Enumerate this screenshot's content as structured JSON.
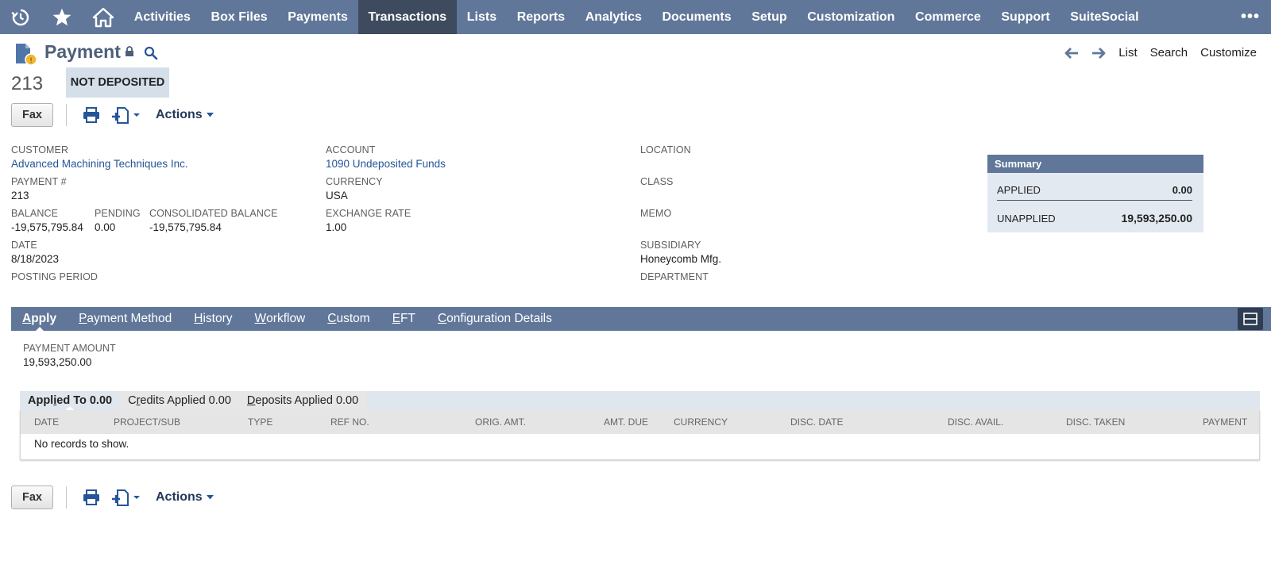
{
  "nav": {
    "items": [
      "Activities",
      "Box Files",
      "Payments",
      "Transactions",
      "Lists",
      "Reports",
      "Analytics",
      "Documents",
      "Setup",
      "Customization",
      "Commerce",
      "Support",
      "SuiteSocial"
    ],
    "active": "Transactions",
    "more": "•••"
  },
  "header": {
    "title": "Payment",
    "record_number": "213",
    "status": "NOT DEPOSITED",
    "links": {
      "list": "List",
      "search": "Search",
      "customize": "Customize"
    }
  },
  "toolbar": {
    "fax": "Fax",
    "actions": "Actions"
  },
  "fields": {
    "customer": {
      "label": "CUSTOMER",
      "value": "Advanced Machining Techniques Inc."
    },
    "payment_no": {
      "label": "PAYMENT #",
      "value": "213"
    },
    "balance": {
      "label": "BALANCE",
      "value": "-19,575,795.84"
    },
    "pending": {
      "label": "PENDING",
      "value": "0.00"
    },
    "consolidated_balance": {
      "label": "CONSOLIDATED BALANCE",
      "value": "-19,575,795.84"
    },
    "date": {
      "label": "DATE",
      "value": "8/18/2023"
    },
    "posting_period": {
      "label": "POSTING PERIOD"
    },
    "account": {
      "label": "ACCOUNT",
      "value": "1090 Undeposited Funds"
    },
    "currency": {
      "label": "CURRENCY",
      "value": "USA"
    },
    "exchange_rate": {
      "label": "EXCHANGE RATE",
      "value": "1.00"
    },
    "location": {
      "label": "LOCATION"
    },
    "class": {
      "label": "CLASS"
    },
    "memo": {
      "label": "MEMO"
    },
    "subsidiary": {
      "label": "SUBSIDIARY",
      "value": "Honeycomb Mfg."
    },
    "department": {
      "label": "DEPARTMENT"
    }
  },
  "summary": {
    "title": "Summary",
    "applied_label": "APPLIED",
    "applied_value": "0.00",
    "unapplied_label": "UNAPPLIED",
    "unapplied_value": "19,593,250.00"
  },
  "subtabs": [
    {
      "first": "A",
      "rest": "pply"
    },
    {
      "first": "P",
      "rest": "ayment Method"
    },
    {
      "first": "H",
      "rest": "istory"
    },
    {
      "first": "W",
      "rest": "orkflow"
    },
    {
      "first": "C",
      "rest": "ustom"
    },
    {
      "first": "E",
      "rest": "FT"
    },
    {
      "first": "C",
      "pre": "",
      "rest": "onfiguration Details"
    }
  ],
  "apply": {
    "payment_amount_label": "PAYMENT AMOUNT",
    "payment_amount_value": "19,593,250.00",
    "tabs": {
      "applied_pre": "Appl",
      "applied_ul": "i",
      "applied_post": "ed To 0.00",
      "credits_pre": "C",
      "credits_ul": "r",
      "credits_post": "edits Applied 0.00",
      "deposits_ul": "D",
      "deposits_post": "eposits Applied 0.00"
    },
    "columns": [
      "DATE",
      "PROJECT/SUB",
      "TYPE",
      "REF NO.",
      "ORIG. AMT.",
      "AMT. DUE",
      "CURRENCY",
      "DISC. DATE",
      "DISC. AVAIL.",
      "DISC. TAKEN",
      "PAYMENT"
    ],
    "empty_message": "No records to show."
  },
  "colors": {
    "nav": "#607799",
    "nav_active": "#3e4b5e",
    "link": "#255599",
    "status_bg": "#d5dfe9"
  }
}
